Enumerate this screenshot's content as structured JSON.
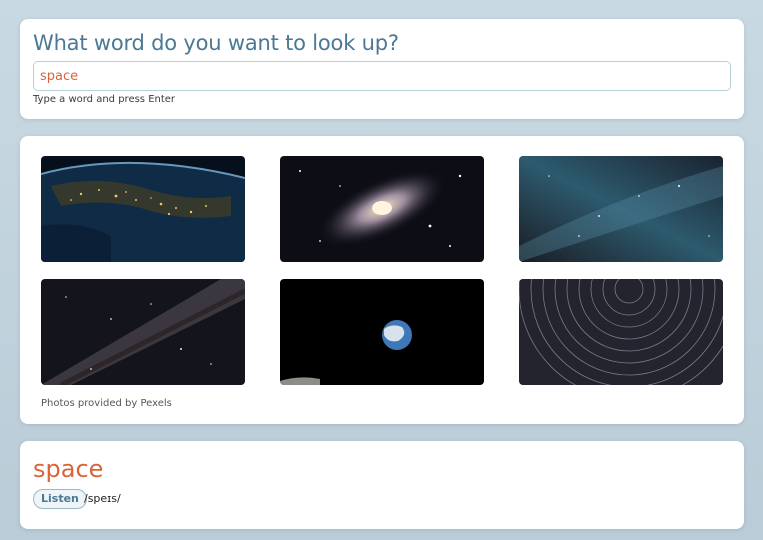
{
  "search": {
    "heading": "What word do you want to look up?",
    "value": "space",
    "hint": "Type a word and press Enter"
  },
  "gallery": {
    "photos": [
      {
        "subject": "earth-from-orbit"
      },
      {
        "subject": "spiral-galaxy"
      },
      {
        "subject": "milky-way-blue"
      },
      {
        "subject": "milky-way-diagonal"
      },
      {
        "subject": "earthrise"
      },
      {
        "subject": "star-trails"
      }
    ],
    "credit": "Photos provided by Pexels"
  },
  "result": {
    "word": "space",
    "listen_label": "Listen",
    "phonetic": "/speɪs/"
  },
  "colors": {
    "accent": "#d9643a",
    "heading": "#4b7894",
    "background": "#c3d5df"
  }
}
